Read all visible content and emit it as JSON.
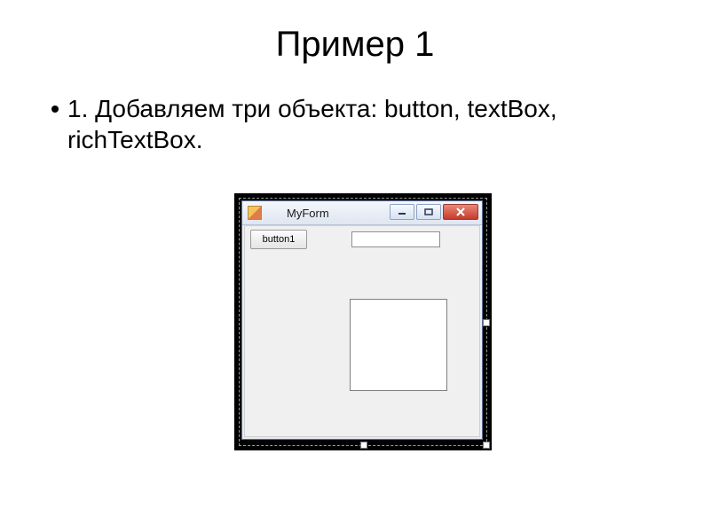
{
  "slide": {
    "title": "Пример 1",
    "bullet": "1. Добавляем три объекта: button, textBox, richTextBox."
  },
  "form": {
    "window_title": "MyForm",
    "button_label": "button1",
    "textbox_value": "",
    "richtextbox_value": "",
    "icons": {
      "minimize": "minimize-icon",
      "maximize": "maximize-icon",
      "close": "close-icon",
      "app": "form-icon"
    }
  }
}
